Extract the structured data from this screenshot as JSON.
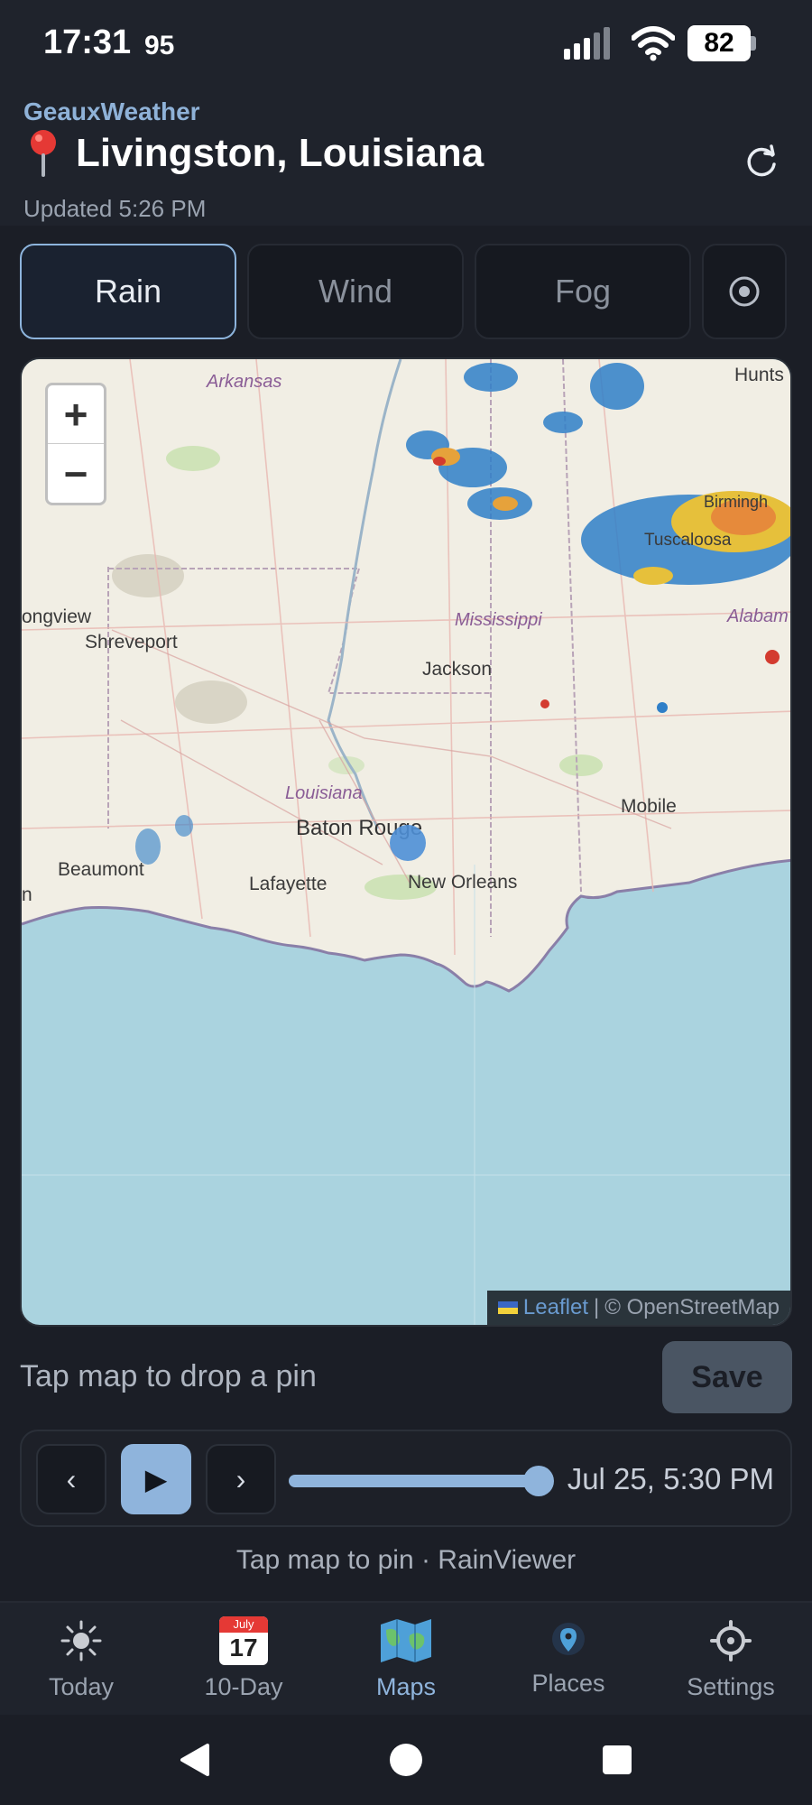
{
  "status_bar": {
    "time": "17:31",
    "secondary": "95",
    "battery": "82"
  },
  "header": {
    "brand": "GeauxWeather",
    "location": "Livingston, Louisiana",
    "updated": "Updated 5:26 PM"
  },
  "tabs": [
    {
      "label": "Rain",
      "active": true
    },
    {
      "label": "Wind",
      "active": false
    },
    {
      "label": "Fog",
      "active": false
    }
  ],
  "map": {
    "zoom_in": "+",
    "zoom_out": "−",
    "labels": {
      "arkansas": "Arkansas",
      "hunts": "Hunts",
      "birmingham": "Birmingh",
      "tuscaloosa": "Tuscaloosa",
      "alabama": "Alabam",
      "longview": "ongview",
      "shreveport": "Shreveport",
      "mississippi": "Mississippi",
      "jackson": "Jackson",
      "louisiana": "Louisiana",
      "mobile": "Mobile",
      "baton_rouge": "Baton Rouge",
      "beaumont": "Beaumont",
      "lafayette": "Lafayette",
      "new_orleans": "New Orleans",
      "edge_n": "n"
    },
    "attribution": {
      "leaflet": "Leaflet",
      "separator": "|",
      "osm": "© OpenStreetMap"
    }
  },
  "pin": {
    "hint": "Tap map to drop a pin",
    "save_label": "Save"
  },
  "player": {
    "prev": "‹",
    "play": "▶",
    "next": "›",
    "timestamp": "Jul 25, 5:30 PM",
    "progress": 1.0
  },
  "source": "Tap map to pin · RainViewer",
  "nav": [
    {
      "label": "Today",
      "icon": "sun-icon"
    },
    {
      "label": "10-Day",
      "icon": "calendar-icon",
      "calendar_month": "July",
      "calendar_day": "17"
    },
    {
      "label": "Maps",
      "icon": "map-icon",
      "active": true
    },
    {
      "label": "Places",
      "icon": "location-pin-icon"
    },
    {
      "label": "Settings",
      "icon": "gear-icon"
    }
  ],
  "colors": {
    "accent": "#8fb4dc",
    "background": "#1b1e26",
    "water": "#aad3df",
    "land": "#f1eee4"
  }
}
